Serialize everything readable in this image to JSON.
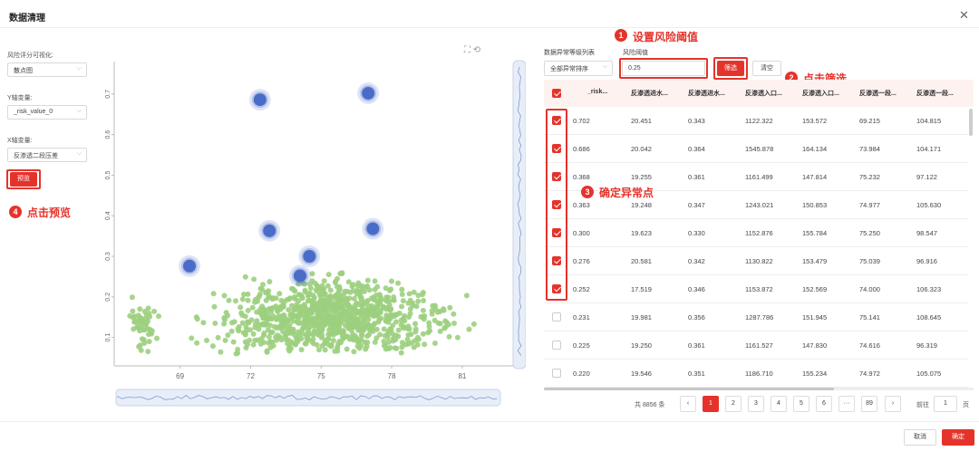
{
  "dialog": {
    "title": "数据清理"
  },
  "left_panel": {
    "viz_label": "风险评分可视化:",
    "viz_value": "散点图",
    "y_label": "Y轴变量:",
    "y_value": "_risk_value_0",
    "x_label": "X轴变量:",
    "x_value": "反渗透二段压差",
    "preview_label": "预览"
  },
  "callouts": {
    "c1_num": "1",
    "c1_text": "设置风险阈值",
    "c2_num": "2",
    "c2_text": "点击筛选",
    "c3_num": "3",
    "c3_text": "确定异常点",
    "c4_num": "4",
    "c4_text": "点击预览"
  },
  "right_panel": {
    "list_label": "数据异常等级列表",
    "sort_value": "全部异常排序",
    "threshold_label": "风险阈值",
    "threshold_value": "0.25",
    "filter_label": "筛选",
    "clear_label": "清空"
  },
  "table": {
    "headers": [
      "_risk...",
      "反渗透进水...",
      "反渗透进水...",
      "反渗透入口...",
      "反渗透入口...",
      "反渗透一段...",
      "反渗透一段..."
    ],
    "rows": [
      {
        "checked": true,
        "cells": [
          "0.702",
          "20.451",
          "0.343",
          "1122.322",
          "153.572",
          "69.215",
          "104.815"
        ]
      },
      {
        "checked": true,
        "cells": [
          "0.686",
          "20.042",
          "0.364",
          "1545.878",
          "164.134",
          "73.984",
          "104.171"
        ]
      },
      {
        "checked": true,
        "cells": [
          "0.368",
          "19.255",
          "0.361",
          "1161.499",
          "147.814",
          "75.232",
          "97.122"
        ]
      },
      {
        "checked": true,
        "cells": [
          "0.363",
          "19.248",
          "0.347",
          "1243.021",
          "150.853",
          "74.977",
          "105.630"
        ]
      },
      {
        "checked": true,
        "cells": [
          "0.300",
          "19.623",
          "0.330",
          "1152.876",
          "155.784",
          "75.250",
          "98.547"
        ]
      },
      {
        "checked": true,
        "cells": [
          "0.276",
          "20.581",
          "0.342",
          "1130.822",
          "153.479",
          "75.039",
          "96.916"
        ]
      },
      {
        "checked": true,
        "cells": [
          "0.252",
          "17.519",
          "0.346",
          "1153.872",
          "152.569",
          "74.000",
          "106.323"
        ]
      },
      {
        "checked": false,
        "cells": [
          "0.231",
          "19.981",
          "0.356",
          "1287.786",
          "151.945",
          "75.141",
          "108.645"
        ]
      },
      {
        "checked": false,
        "cells": [
          "0.225",
          "19.250",
          "0.361",
          "1161.527",
          "147.830",
          "74.616",
          "96.319"
        ]
      },
      {
        "checked": false,
        "cells": [
          "0.220",
          "19.546",
          "0.351",
          "1186.710",
          "155.234",
          "74.972",
          "105.075"
        ]
      }
    ]
  },
  "pagination": {
    "total": "共 8856 条",
    "pages": [
      "1",
      "2",
      "3",
      "4",
      "5",
      "6",
      "···",
      "89"
    ],
    "prev": "‹",
    "next": "›",
    "goto_label": "前往",
    "goto_value": "1",
    "goto_suffix": "页"
  },
  "footer": {
    "cancel": "取消",
    "ok": "确定"
  },
  "chart_data": {
    "type": "scatter",
    "x_ticks": [
      69,
      72,
      75,
      78,
      81
    ],
    "y_ticks": [
      0.1,
      0.2,
      0.3,
      0.4,
      0.5,
      0.6,
      0.7
    ],
    "xlim": [
      66.2,
      83.2
    ],
    "ylim": [
      0.03,
      0.78
    ],
    "grid": false,
    "highlight_color": "#4a6cc8",
    "normal_color": "#9ccf7e",
    "series": [
      {
        "highlighted": true,
        "x": [
          72.4,
          77.0,
          72.8,
          77.2,
          69.4,
          74.5,
          74.1
        ],
        "y": [
          0.686,
          0.702,
          0.363,
          0.368,
          0.276,
          0.3,
          0.252
        ]
      },
      {
        "highlighted": false,
        "clusters": [
          {
            "cx": 67.4,
            "cy": 0.13,
            "sx": 0.3,
            "sy": 0.03,
            "n": 50
          },
          {
            "cx": 75.5,
            "cy": 0.14,
            "sx": 2.3,
            "sy": 0.04,
            "n": 800
          },
          {
            "cx": 75.5,
            "cy": 0.19,
            "sx": 1.5,
            "sy": 0.035,
            "n": 150
          }
        ]
      }
    ]
  }
}
